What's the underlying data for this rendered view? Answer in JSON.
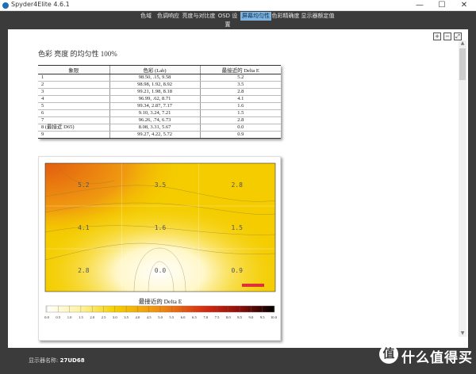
{
  "window": {
    "title": "Spyder4Elite 4.6.1",
    "min_glyph": "—",
    "max_glyph": "☐",
    "close_glyph": "✕"
  },
  "tabs": [
    {
      "label": "色域",
      "active": false
    },
    {
      "label": "色调响应",
      "active": false
    },
    {
      "label": "亮度与对比度",
      "active": false
    },
    {
      "label": "OSD 设置",
      "active": false
    },
    {
      "label": "屏幕均匀性",
      "active": true
    },
    {
      "label": "色彩精确度",
      "active": false
    },
    {
      "label": "显示器额定值",
      "active": false
    }
  ],
  "toolbar": {
    "icons": [
      "zoom-in-icon",
      "zoom-out-icon",
      "zoom-fit-icon"
    ]
  },
  "report": {
    "title": "色彩 亮度 的均匀性 100%"
  },
  "table": {
    "headers": [
      "象限",
      "色彩 (Lab)",
      "最接近的 Delta E"
    ],
    "rows": [
      [
        "1",
        "98.50,   .15,   9.58",
        "5.2"
      ],
      [
        "2",
        "98.98,  1.92,   8.92",
        "3.5"
      ],
      [
        "3",
        "99.21,  1.98,   8.18",
        "2.8"
      ],
      [
        "4",
        "96.99,   .62,   8.71",
        "4.1"
      ],
      [
        "5",
        "99.34,  2.87,   7.17",
        "1.6"
      ],
      [
        "6",
        "9.10,  3.24,   7.21",
        "1.5"
      ],
      [
        "7",
        "96.26,   .74,   6.73",
        "2.8"
      ],
      [
        "8 (最接近 D65)",
        "8.08,  3.31,   5.67",
        "0.0"
      ],
      [
        "9",
        "99.27,  4.22,   5.72",
        "0.9"
      ]
    ]
  },
  "heatmap": {
    "cells": [
      [
        "5.2",
        "3.5",
        "2.8"
      ],
      [
        "4.1",
        "1.6",
        "1.5"
      ],
      [
        "2.8",
        "0.0",
        "0.9"
      ]
    ],
    "legend_title": "最接近的 Delta E",
    "scale_labels": [
      "0.0",
      "0.5",
      "1.0",
      "1.5",
      "2.0",
      "2.5",
      "3.0",
      "3.5",
      "4.0",
      "4.5",
      "5.0",
      "5.5",
      "6.0",
      "6.5",
      "7.0",
      "7.5",
      "8.0",
      "8.5",
      "9.0",
      "9.5",
      "10.0"
    ],
    "colors": {
      "low": "#ffffff",
      "mid": "#f5d000",
      "high": "#e35d10",
      "max": "#000000"
    }
  },
  "status": {
    "label": "显示器名称:",
    "value": "27UD68"
  },
  "watermark": {
    "badge": "值",
    "text": "什么值得买"
  }
}
